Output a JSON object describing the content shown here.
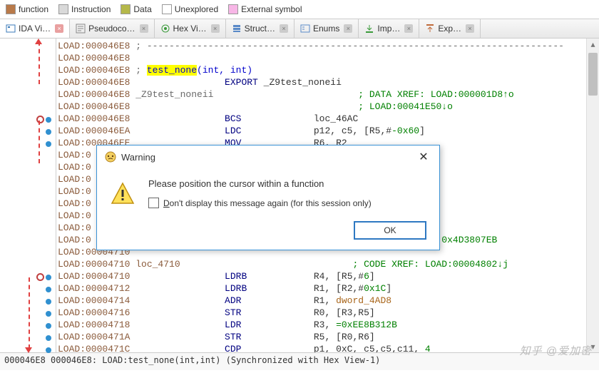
{
  "legend": {
    "items": [
      {
        "label": "function",
        "color": "#b97a4a"
      },
      {
        "label": "Instruction",
        "color": "#d9d9d9"
      },
      {
        "label": "Data",
        "color": "#b5b84a"
      },
      {
        "label": "Unexplored",
        "color": "#ffffff"
      },
      {
        "label": "External symbol",
        "color": "#f7b6e6"
      }
    ]
  },
  "tabs": [
    {
      "label": "IDA Vi…",
      "active": true,
      "close": "red"
    },
    {
      "label": "Pseudoco…",
      "active": false,
      "close": "gray"
    },
    {
      "label": "Hex Vi…",
      "active": false,
      "close": "gray"
    },
    {
      "label": "Struct…",
      "active": false,
      "close": "gray"
    },
    {
      "label": "Enums",
      "active": false,
      "close": "gray"
    },
    {
      "label": "Imp…",
      "active": false,
      "close": "gray"
    },
    {
      "label": "Exp…",
      "active": false,
      "close": "gray"
    }
  ],
  "code": {
    "lines": [
      {
        "addr": "LOAD:000046E8",
        "text": " ; ---------------------------------------------------------------------------"
      },
      {
        "addr": "LOAD:000046E8",
        "text": ""
      },
      {
        "addr": "LOAD:000046E8",
        "text": " ; ",
        "hl": "test_none",
        "tail": "(int, int)",
        "nameColor": true
      },
      {
        "addr": "LOAD:000046E8",
        "spaces": "                 ",
        "op": "EXPORT",
        "arg": " _Z9test_noneii"
      },
      {
        "addr": "LOAD:000046E8",
        "text": " _Z9test_noneii",
        "ref": "                          ; DATA XREF: LOAD:000001D8↑o"
      },
      {
        "addr": "LOAD:000046E8",
        "ref": "                                         ; LOAD:00041E50↓o"
      },
      {
        "addr": "LOAD:000046E8",
        "spaces": "                 ",
        "op": "BCS",
        "arg": "             loc_46AC"
      },
      {
        "addr": "LOAD:000046EA",
        "spaces": "                 ",
        "op": "LDC",
        "arg": "             p12, c5, [R5,#",
        "num": "-0x60",
        "arg2": "]"
      },
      {
        "addr": "LOAD:000046EE",
        "spaces": "                 ",
        "op": "MOV",
        "arg": "             R6, R2"
      },
      {
        "addr": "LOAD:0",
        "text": ""
      },
      {
        "addr": "LOAD:0",
        "text": ""
      },
      {
        "addr": "LOAD:0",
        "text": ""
      },
      {
        "addr": "LOAD:0",
        "text": ""
      },
      {
        "addr": "LOAD:0",
        "text": ""
      },
      {
        "addr": "LOAD:0",
        "text": ""
      },
      {
        "addr": "LOAD:0",
        "text": ""
      },
      {
        "addr": "LOAD:0",
        "tailnums": ", 0x9A3F16B6, 0x4D3807EB"
      },
      {
        "addr": "LOAD:00004710",
        "text": ""
      },
      {
        "addr": "LOAD:00004710",
        "loc": " loc_4710",
        "ref": "                               ; CODE XREF: LOAD:00004802↓j"
      },
      {
        "addr": "LOAD:00004710",
        "spaces": "                 ",
        "op": "LDRB",
        "arg": "            R4, [R5,#",
        "num": "6",
        "arg2": "]"
      },
      {
        "addr": "LOAD:00004712",
        "spaces": "                 ",
        "op": "LDRB",
        "arg": "            R1, [R2,#",
        "num": "0x1C",
        "arg2": "]"
      },
      {
        "addr": "LOAD:00004714",
        "spaces": "                 ",
        "op": "ADR",
        "arg": "             R1, ",
        "dword": "dword_4AD8"
      },
      {
        "addr": "LOAD:00004716",
        "spaces": "                 ",
        "op": "STR",
        "arg": "             R0, [R3,R5]"
      },
      {
        "addr": "LOAD:00004718",
        "spaces": "                 ",
        "op": "LDR",
        "arg": "             R3, ",
        "eq": "=",
        "hex": "0xEE8B312B"
      },
      {
        "addr": "LOAD:0000471A",
        "spaces": "                 ",
        "op": "STR",
        "arg": "             R5, [R0,R6]"
      },
      {
        "addr": "LOAD:0000471C",
        "spaces": "                 ",
        "op": "CDP",
        "arg": "             p1, 0xC, c5,c5,c11, ",
        "num2": "4"
      }
    ]
  },
  "dialog": {
    "title": "Warning",
    "message": "Please position the cursor within a function",
    "checkbox": "Don't display this message again (for this session only)",
    "ok": "OK"
  },
  "statusbar": "000046E8 000046E8: LOAD:test_none(int,int) (Synchronized with Hex View-1)",
  "watermark": "知乎 @爱加密"
}
